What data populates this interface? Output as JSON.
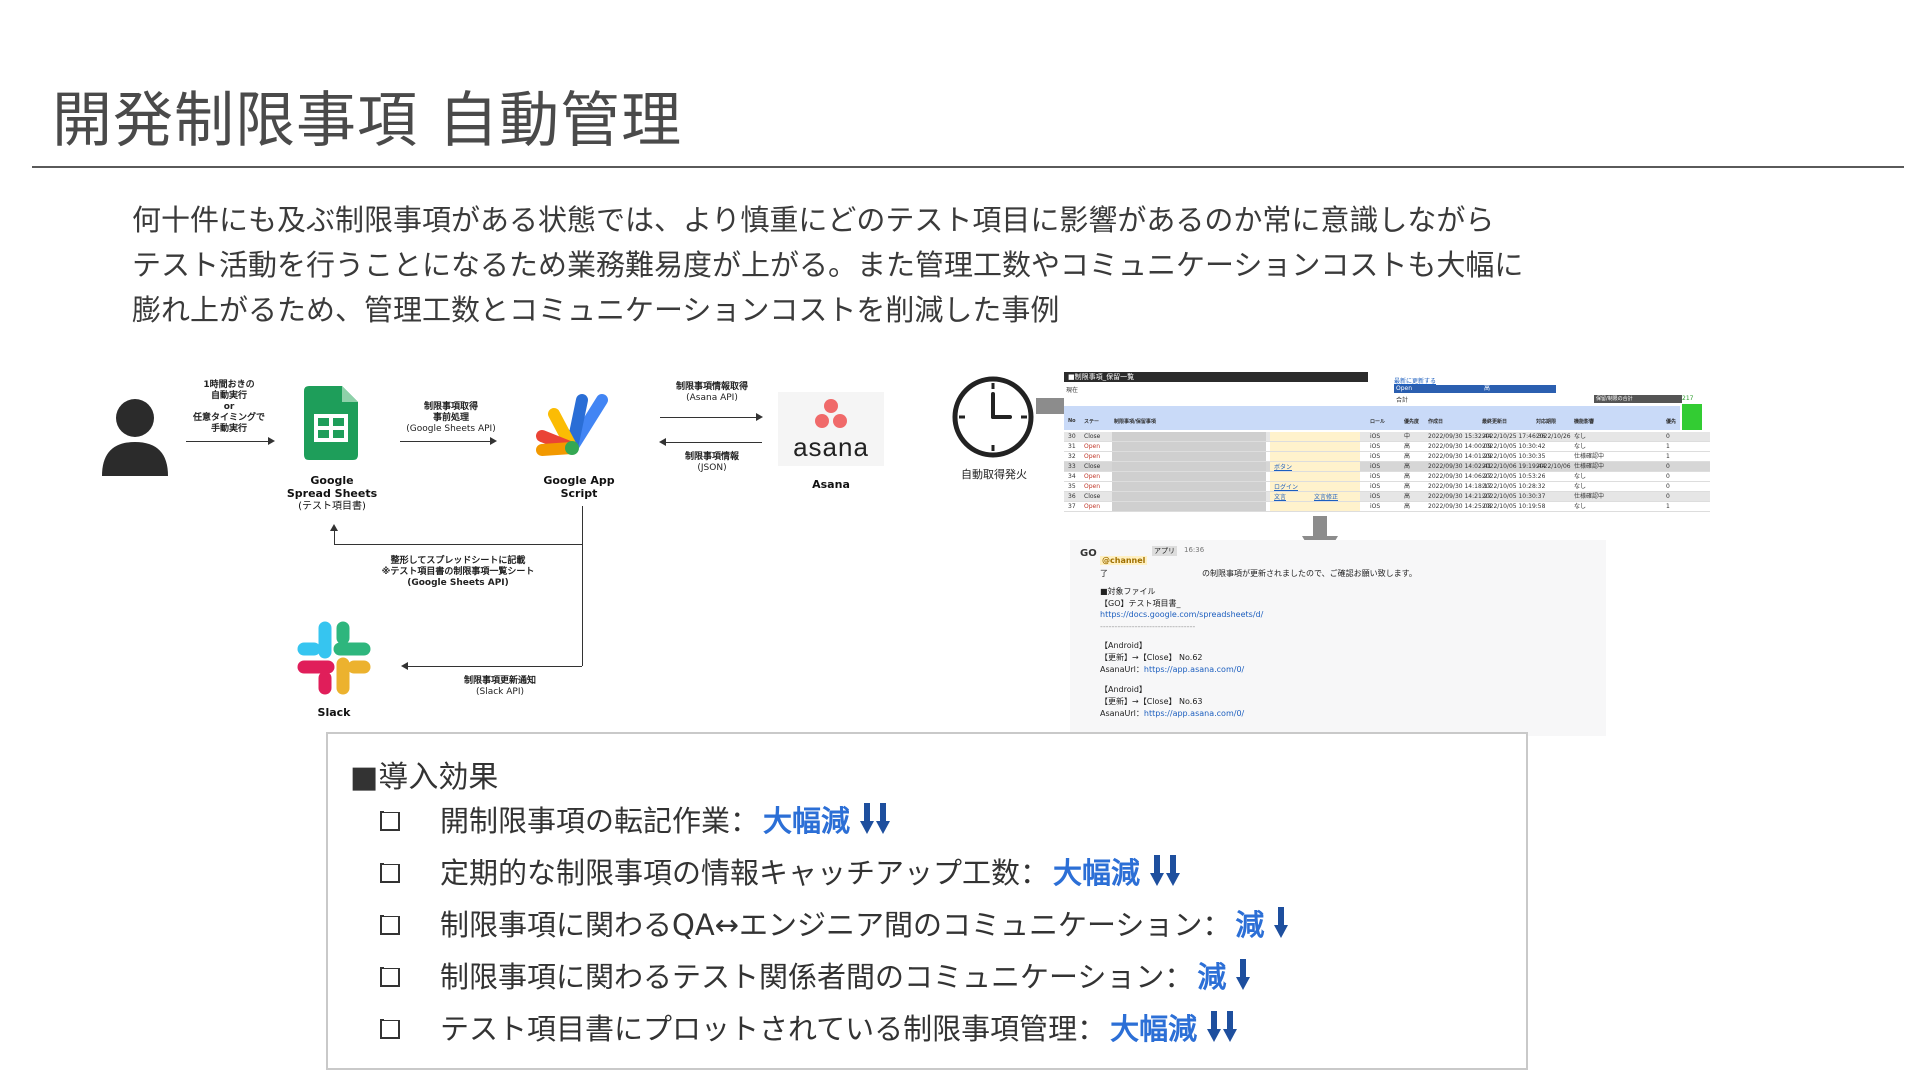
{
  "slide": {
    "title": "開発制限事項 自動管理",
    "intro_lines": [
      "何十件にも及ぶ制限事項がある状態では、より慎重にどのテスト項目に影響があるのか常に意識しながら",
      "テスト活動を行うことになるため業務難易度が上がる。また管理工数やコミュニケーションコストも大幅に",
      "膨れ上がるため、管理工数とコミュニケーションコストを削減した事例"
    ]
  },
  "diagram": {
    "trigger_label": [
      "1時間おきの",
      "自動実行",
      "or",
      "任意タイミングで",
      "手動実行"
    ],
    "sheets_name": [
      "Google",
      "Spread Sheets",
      "(テスト項目書)"
    ],
    "fetch_label": [
      "制限事項取得",
      "事前処理",
      "(Google Sheets API)"
    ],
    "gas_name": [
      "Google App",
      "Script"
    ],
    "asana_fetch_label": [
      "制限事項情報取得",
      "(Asana API)"
    ],
    "asana_return_label": [
      "制限事項情報",
      "(JSON)"
    ],
    "asana_logo_text": "asana",
    "asana_name": "Asana",
    "write_back_label": [
      "整形してスプレッドシートに記載",
      "※テスト項目書の制限事項一覧シート",
      "(Google Sheets API)"
    ],
    "notify_label": [
      "制限事項更新通知",
      "(Slack API)"
    ],
    "slack_name": "Slack",
    "clock_label": "自動取得発火"
  },
  "sheet_mock": {
    "header_title": "■制限事項_保留一覧",
    "filter_label": "現在",
    "link_label": "最新に更新する",
    "open_label": "Open",
    "high_label": "高",
    "count_label": "合計",
    "sum_label": "保留/制限の合計",
    "sum_value": "217",
    "columns": [
      "No",
      "ステー",
      "制限事項/保留事項",
      "ロール",
      "優先度",
      "作成日",
      "最終更新日",
      "対応期限",
      "機能影響",
      "優先"
    ],
    "rows": [
      {
        "no": "30",
        "status": "Close",
        "role": "iOS",
        "prio": "中",
        "created": "2022/09/30 15:32:44",
        "updated": "2022/10/25 17:46:36",
        "due": "2022/10/26",
        "impact": "なし",
        "flag": "0"
      },
      {
        "no": "31",
        "status": "Open",
        "role": "iOS",
        "prio": "高",
        "created": "2022/09/30 14:00:09",
        "updated": "2022/10/05 10:30:42",
        "due": "",
        "impact": "なし",
        "flag": "1"
      },
      {
        "no": "32",
        "status": "Open",
        "role": "iOS",
        "prio": "高",
        "created": "2022/09/30 14:01:29",
        "updated": "2022/10/05 10:30:35",
        "due": "",
        "impact": "仕様確認中",
        "flag": "1"
      },
      {
        "no": "33",
        "status": "Close",
        "role": "iOS",
        "prio": "高",
        "created": "2022/09/30 14:02:41",
        "updated": "2022/10/06 19:19:44",
        "due": "2022/10/06",
        "impact": "仕様確認中",
        "flag": "0"
      },
      {
        "no": "34",
        "status": "Open",
        "role": "iOS",
        "prio": "高",
        "created": "2022/09/30 14:06:27",
        "updated": "2022/10/05 10:53:26",
        "due": "",
        "impact": "なし",
        "flag": "0"
      },
      {
        "no": "35",
        "status": "Open",
        "role": "iOS",
        "prio": "高",
        "created": "2022/09/30 14:18:17",
        "updated": "2022/10/05 10:28:32",
        "due": "",
        "impact": "なし",
        "flag": "0"
      },
      {
        "no": "36",
        "status": "Close",
        "role": "iOS",
        "prio": "高",
        "created": "2022/09/30 14:21:27",
        "updated": "2022/10/05 10:30:37",
        "due": "",
        "impact": "仕様確認中",
        "flag": "0"
      },
      {
        "no": "37",
        "status": "Open",
        "role": "iOS",
        "prio": "高",
        "created": "2022/09/30 14:25:08",
        "updated": "2022/10/05 10:19:58",
        "due": "",
        "impact": "なし",
        "flag": "1"
      }
    ],
    "row_notes": {
      "r33": "ボタン",
      "r35": "ログイン",
      "r36": "文言",
      "r36b": "文言修正"
    }
  },
  "slack_mock": {
    "app_badge": "GO",
    "app_tag": "アプリ",
    "time": "16:36",
    "mention": "@channel",
    "line1_prefix": "了",
    "line1": "の制限事項が更新されましたので、ご確認お願い致します。",
    "target_header": "■対象ファイル",
    "target_file": "【GO】テスト項目書_",
    "sheet_url": "https://docs.google.com/spreadsheets/d/",
    "separator": "---------------------------------",
    "blocks": [
      {
        "platform": "【Android】",
        "change": "【更新】→【Close】 No.62",
        "url_label": "AsanaUrl：",
        "url": "https://app.asana.com/0/"
      },
      {
        "platform": "【Android】",
        "change": "【更新】→【Close】 No.63",
        "url_label": "AsanaUrl：",
        "url": "https://app.asana.com/0/"
      }
    ]
  },
  "effects": {
    "title": "■導入効果",
    "items": [
      {
        "text": "開制限事項の転記作業：",
        "result": "大幅減",
        "arrows": 2
      },
      {
        "text": "定期的な制限事項の情報キャッチアップ工数：",
        "result": "大幅減",
        "arrows": 2
      },
      {
        "text": "制限事項に関わるQA↔エンジニア間のコミュニケーション：",
        "result": "減",
        "arrows": 1
      },
      {
        "text": "制限事項に関わるテスト関係者間のコミュニケーション：",
        "result": "減",
        "arrows": 1
      },
      {
        "text": "テスト項目書にプロットされている制限事項管理：",
        "result": "大幅減",
        "arrows": 2
      }
    ]
  },
  "colors": {
    "accent_blue": "#2c6fd6",
    "arrow_blue": "#1e4f9e",
    "sheets_green": "#1e9e5a",
    "asana_red": "#f06a6a",
    "sheet_header_blue": "#c9daf8",
    "sheet_highlight_yellow": "#fff2cc",
    "sheet_green_cell": "#33cc33"
  }
}
